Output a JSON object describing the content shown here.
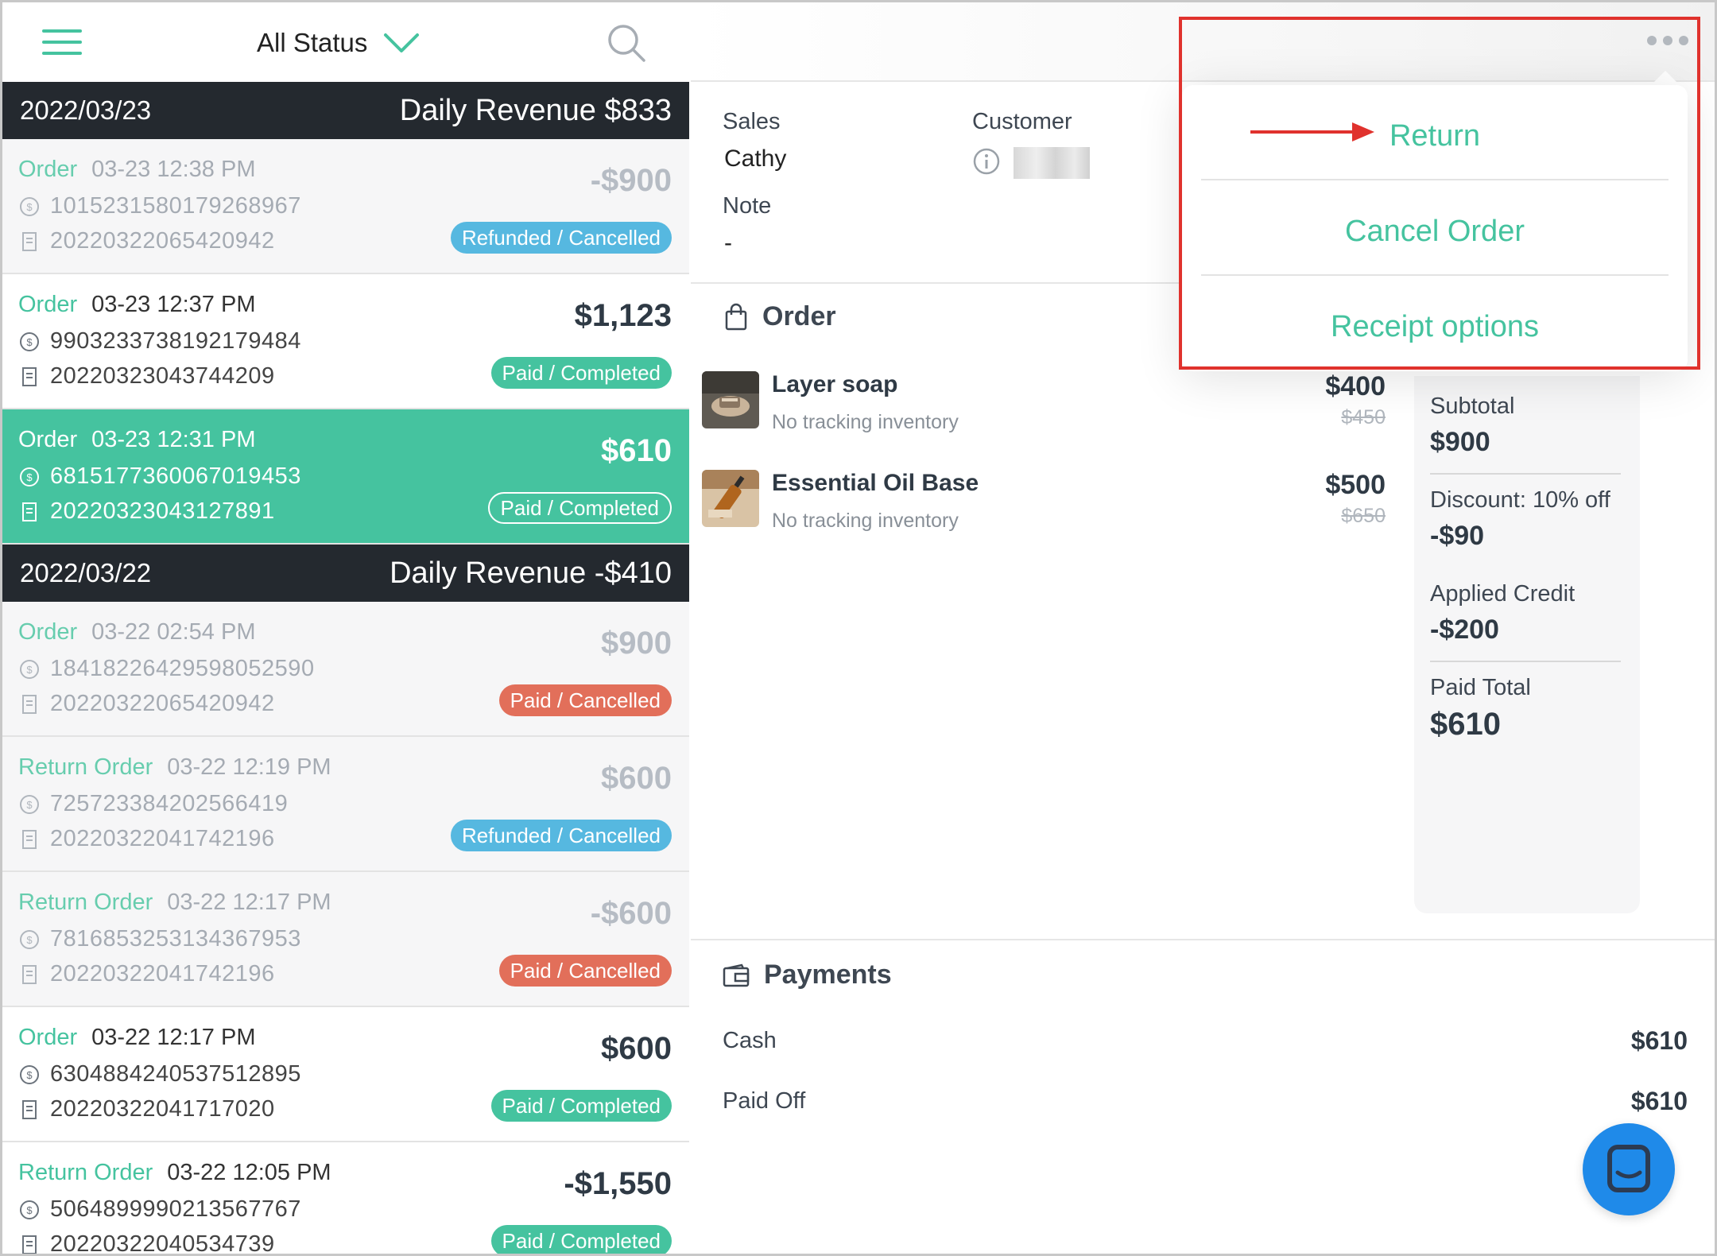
{
  "left": {
    "filter_label": "All Status",
    "days": [
      {
        "date": "2022/03/23",
        "revenue": "Daily Revenue $833",
        "orders": [
          {
            "type": "Order",
            "time": "03-23 12:38 PM",
            "txn": "1015231580179268967",
            "receipt": "20220322065420942",
            "amount": "-$900",
            "status": "Refunded / Cancelled",
            "style": "dim",
            "badge": "refunded"
          },
          {
            "type": "Order",
            "time": "03-23 12:37 PM",
            "txn": "9903233738192179484",
            "receipt": "20220323043744209",
            "amount": "$1,123",
            "status": "Paid / Completed",
            "style": "white",
            "badge": "paid"
          },
          {
            "type": "Order",
            "time": "03-23 12:31 PM",
            "txn": "6815177360067019453",
            "receipt": "20220323043127891",
            "amount": "$610",
            "status": "Paid / Completed",
            "style": "active",
            "badge": "outline"
          }
        ]
      },
      {
        "date": "2022/03/22",
        "revenue": "Daily Revenue -$410",
        "orders": [
          {
            "type": "Order",
            "time": "03-22 02:54 PM",
            "txn": "18418226429598052590",
            "receipt": "20220322065420942",
            "amount": "$900",
            "status": "Paid / Cancelled",
            "style": "dim",
            "badge": "cancel"
          },
          {
            "type": "Return Order",
            "time": "03-22 12:19 PM",
            "txn": "725723384202566419",
            "receipt": "20220322041742196",
            "amount": "$600",
            "status": "Refunded / Cancelled",
            "style": "dim",
            "badge": "refunded"
          },
          {
            "type": "Return Order",
            "time": "03-22 12:17 PM",
            "txn": "7816853253134367953",
            "receipt": "20220322041742196",
            "amount": "-$600",
            "status": "Paid / Cancelled",
            "style": "dim",
            "badge": "cancel"
          },
          {
            "type": "Order",
            "time": "03-22 12:17 PM",
            "txn": "6304884240537512895",
            "receipt": "20220322041717020",
            "amount": "$600",
            "status": "Paid / Completed",
            "style": "white",
            "badge": "paid"
          },
          {
            "type": "Return Order",
            "time": "03-22 12:05 PM",
            "txn": "5064899990213567767",
            "receipt": "20220322040534739",
            "amount": "-$1,550",
            "status": "Paid / Completed",
            "style": "white",
            "badge": "paid"
          }
        ]
      }
    ]
  },
  "detail": {
    "sales_label": "Sales",
    "sales_value": "Cathy",
    "customer_label": "Customer",
    "note_label": "Note",
    "note_value": "-",
    "order_title": "Order",
    "items": [
      {
        "name": "Layer soap",
        "sub": "No tracking inventory",
        "price": "$400",
        "orig": "$450"
      },
      {
        "name": "Essential Oil Base",
        "sub": "No tracking inventory",
        "price": "$500",
        "orig": "$650"
      }
    ],
    "summary": {
      "subtotal_label": "Subtotal",
      "subtotal": "$900",
      "discount_label": "Discount: 10% off",
      "discount": "-$90",
      "credit_label": "Applied Credit",
      "credit": "-$200",
      "paid_label": "Paid Total",
      "paid": "$610"
    },
    "payments_title": "Payments",
    "payments": [
      {
        "label": "Cash",
        "value": "$610"
      },
      {
        "label": "Paid Off",
        "value": "$610"
      }
    ]
  },
  "menu": {
    "return": "Return",
    "cancel": "Cancel Order",
    "receipt": "Receipt options"
  },
  "colors": {
    "accent": "#45c39f",
    "dark": "#24292f",
    "refunded": "#56b8e0",
    "cancelled": "#e26f5a",
    "highlight": "#e0322d",
    "fab": "#1f8ae9"
  }
}
